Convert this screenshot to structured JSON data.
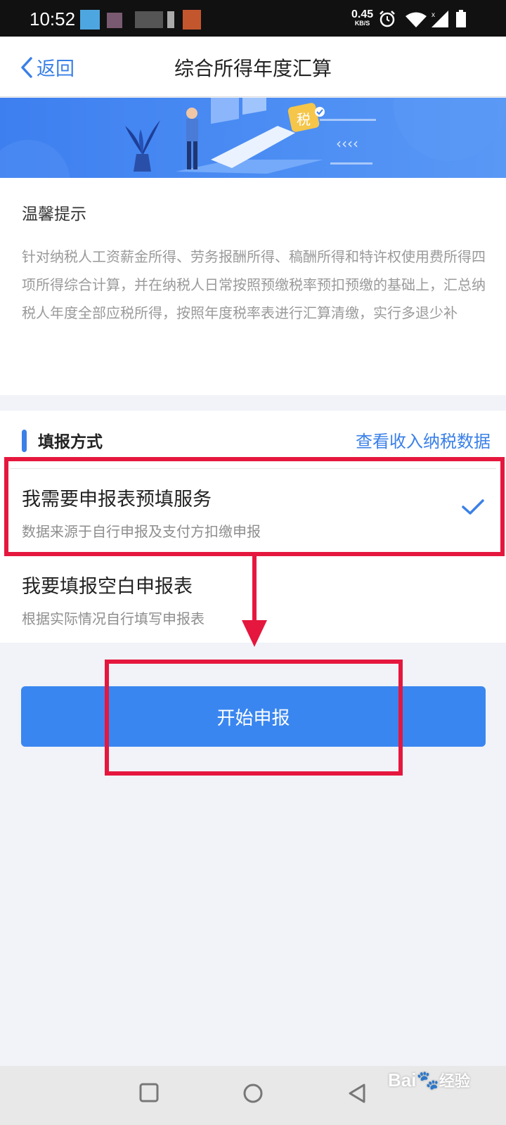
{
  "status_bar": {
    "time": "10:52",
    "net_speed": "0.45",
    "net_unit": "KB/S",
    "icons": [
      "alarm-icon",
      "wifi-icon",
      "signal-icon",
      "battery-icon"
    ]
  },
  "header": {
    "back_label": "返回",
    "title": "综合所得年度汇算"
  },
  "banner": {
    "badge_text": "税"
  },
  "tips": {
    "title": "温馨提示",
    "body": "针对纳税人工资薪金所得、劳务报酬所得、稿酬所得和特许权使用费所得四项所得综合计算，并在纳税人日常按照预缴税率预扣预缴的基础上，汇总纳税人年度全部应税所得，按照年度税率表进行汇算清缴，实行多退少补"
  },
  "method": {
    "title": "填报方式",
    "link": "查看收入纳税数据",
    "options": [
      {
        "title": "我需要申报表预填服务",
        "subtitle": "数据来源于自行申报及支付方扣缴申报",
        "selected": true
      },
      {
        "title": "我要填报空白申报表",
        "subtitle": "根据实际情况自行填写申报表",
        "selected": false
      }
    ]
  },
  "start_button": "开始申报",
  "watermark": {
    "latin": "Bai",
    "cn": "经验"
  },
  "colors": {
    "accent": "#3a80e8",
    "button": "#3a86f0",
    "annotation": "#e5173e"
  }
}
